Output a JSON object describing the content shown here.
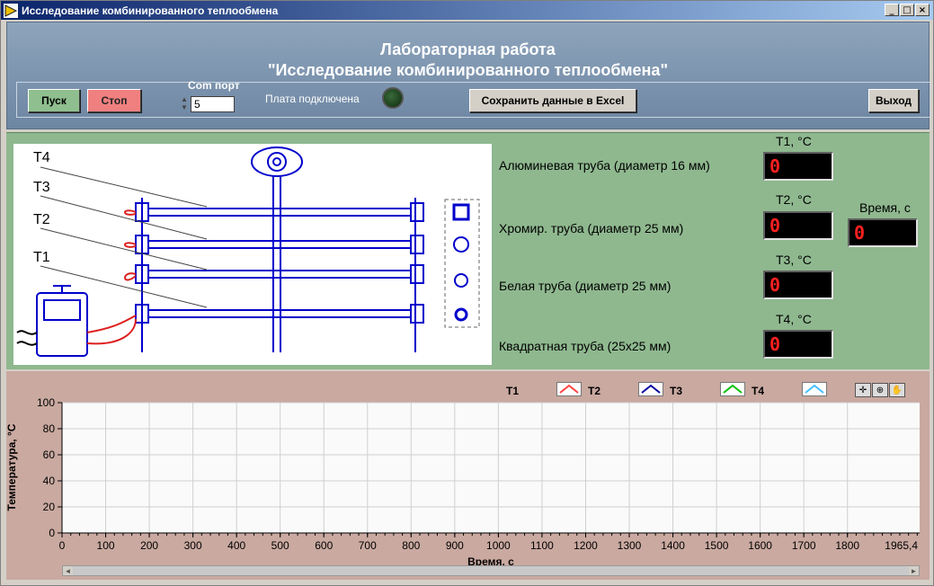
{
  "window": {
    "title": "Исследование комбинированного теплообмена",
    "buttons": {
      "minimize": "_",
      "maximize": "□",
      "close": "×"
    }
  },
  "header": {
    "title_line1": "Лабораторная работа",
    "title_line2": "\"Исследование комбинированного теплообмена\""
  },
  "toolbar": {
    "start_label": "Пуск",
    "stop_label": "Стоп",
    "com_port_label": "Com порт",
    "com_port_value": "5",
    "board_connected_label": "Плата подключена",
    "save_excel_label": "Сохранить данные в Excel",
    "exit_label": "Выход"
  },
  "scheme": {
    "sensor_labels": [
      "T4",
      "T3",
      "T2",
      "T1"
    ]
  },
  "readings": {
    "pipes": [
      {
        "label": "Алюминевая труба (диаметр 16 мм)",
        "t_label": "T1, °C",
        "value": "0"
      },
      {
        "label": "Хромир. труба (диаметр 25 мм)",
        "t_label": "T2, °C",
        "value": "0"
      },
      {
        "label": "Белая труба (диаметр 25 мм)",
        "t_label": "T3, °C",
        "value": "0"
      },
      {
        "label": "Квадратная труба (25х25 мм)",
        "t_label": "T4, °C",
        "value": "0"
      }
    ],
    "time_label": "Время, с",
    "time_value": "0"
  },
  "legend": [
    {
      "name": "T1",
      "color": "#ff4040"
    },
    {
      "name": "T2",
      "color": "#0000a0"
    },
    {
      "name": "T3",
      "color": "#00c000"
    },
    {
      "name": "T4",
      "color": "#40c0ff"
    }
  ],
  "chart_data": {
    "type": "line",
    "xlabel": "Время, с",
    "ylabel": "Температура, °C",
    "xlim": [
      0,
      1965.4
    ],
    "ylim": [
      0,
      100
    ],
    "x_ticks": [
      0,
      100,
      200,
      300,
      400,
      500,
      600,
      700,
      800,
      900,
      1000,
      1100,
      1200,
      1300,
      1400,
      1500,
      1600,
      1700,
      1800
    ],
    "x_last_tick": "1965,4",
    "y_ticks": [
      0,
      20,
      40,
      60,
      80,
      100
    ],
    "grid": true,
    "series": [
      {
        "name": "T1",
        "values": []
      },
      {
        "name": "T2",
        "values": []
      },
      {
        "name": "T3",
        "values": []
      },
      {
        "name": "T4",
        "values": []
      }
    ]
  },
  "colors": {
    "header_bg": "#7890aa",
    "mid_panel_bg": "#8fb88f",
    "chart_panel_bg": "#c9a9a0",
    "display_text": "#ff2020",
    "scheme_blue": "#0000cc"
  }
}
